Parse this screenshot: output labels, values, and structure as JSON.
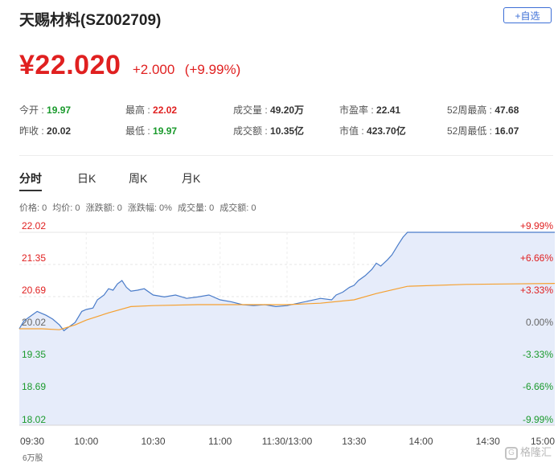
{
  "header": {
    "title": "天赐材料(SZ002709)",
    "add_button": "+自选"
  },
  "quote": {
    "price": "¥22.020",
    "change": "+2.000",
    "change_pct": "(+9.99%)"
  },
  "stats": {
    "row1": [
      {
        "label": "今开 : ",
        "value": "19.97",
        "tone": "green"
      },
      {
        "label": "最高 : ",
        "value": "22.02",
        "tone": "red"
      },
      {
        "label": "成交量 : ",
        "value": "49.20万",
        "tone": "dark"
      },
      {
        "label": "市盈率 : ",
        "value": "22.41",
        "tone": "dark"
      },
      {
        "label": "52周最高 : ",
        "value": "47.68",
        "tone": "dark"
      }
    ],
    "row2": [
      {
        "label": "昨收 : ",
        "value": "20.02",
        "tone": "dark"
      },
      {
        "label": "最低 : ",
        "value": "19.97",
        "tone": "green"
      },
      {
        "label": "成交额 : ",
        "value": "10.35亿",
        "tone": "dark"
      },
      {
        "label": "市值 : ",
        "value": "423.70亿",
        "tone": "dark"
      },
      {
        "label": "52周最低 : ",
        "value": "16.07",
        "tone": "dark"
      }
    ]
  },
  "tabs": [
    {
      "label": "分时",
      "active": true
    },
    {
      "label": "日K",
      "active": false
    },
    {
      "label": "周K",
      "active": false
    },
    {
      "label": "月K",
      "active": false
    }
  ],
  "info_line": [
    "价格: 0",
    "均价: 0",
    "涨跌额: 0",
    "涨跌幅: 0%",
    "成交量: 0",
    "成交额: 0"
  ],
  "volume_label": "6万股",
  "watermark": {
    "logo": "G",
    "text": "格隆汇"
  },
  "colors": {
    "up": "#e02020",
    "down": "#1a9a2c",
    "price_line": "#4a7cc9",
    "avg_line": "#f5a030",
    "area_fill": "#e6ecfa",
    "accent": "#3d6fd6"
  },
  "chart_data": {
    "type": "line",
    "y_left_labels": [
      "22.02",
      "21.35",
      "20.69",
      "20.02",
      "19.35",
      "18.69",
      "18.02"
    ],
    "y_right_labels": [
      "+9.99%",
      "+6.66%",
      "+3.33%",
      "0.00%",
      "-3.33%",
      "-6.66%",
      "-9.99%"
    ],
    "x_labels": [
      "09:30",
      "10:00",
      "10:30",
      "11:00",
      "11:30/13:00",
      "13:30",
      "14:00",
      "14:30",
      "15:00"
    ],
    "ylim": [
      18.02,
      22.02
    ],
    "prev_close": 20.02,
    "grid": true,
    "series": [
      {
        "key": "price",
        "points": [
          [
            0,
            20.02
          ],
          [
            2,
            20.18
          ],
          [
            5,
            20.28
          ],
          [
            8,
            20.38
          ],
          [
            12,
            20.3
          ],
          [
            15,
            20.22
          ],
          [
            18,
            20.1
          ],
          [
            20,
            19.98
          ],
          [
            22,
            20.05
          ],
          [
            25,
            20.15
          ],
          [
            28,
            20.38
          ],
          [
            30,
            20.42
          ],
          [
            33,
            20.45
          ],
          [
            35,
            20.62
          ],
          [
            38,
            20.72
          ],
          [
            40,
            20.85
          ],
          [
            42,
            20.82
          ],
          [
            44,
            20.95
          ],
          [
            46,
            21.02
          ],
          [
            48,
            20.88
          ],
          [
            50,
            20.8
          ],
          [
            53,
            20.82
          ],
          [
            56,
            20.85
          ],
          [
            60,
            20.72
          ],
          [
            65,
            20.68
          ],
          [
            70,
            20.72
          ],
          [
            75,
            20.65
          ],
          [
            80,
            20.68
          ],
          [
            85,
            20.72
          ],
          [
            90,
            20.62
          ],
          [
            95,
            20.58
          ],
          [
            100,
            20.52
          ],
          [
            105,
            20.5
          ],
          [
            110,
            20.52
          ],
          [
            115,
            20.48
          ],
          [
            120,
            20.5
          ],
          [
            125,
            20.55
          ],
          [
            130,
            20.6
          ],
          [
            135,
            20.65
          ],
          [
            140,
            20.62
          ],
          [
            142,
            20.72
          ],
          [
            145,
            20.78
          ],
          [
            148,
            20.88
          ],
          [
            150,
            20.92
          ],
          [
            152,
            21.02
          ],
          [
            155,
            21.12
          ],
          [
            158,
            21.25
          ],
          [
            160,
            21.38
          ],
          [
            162,
            21.32
          ],
          [
            165,
            21.45
          ],
          [
            167,
            21.55
          ],
          [
            170,
            21.78
          ],
          [
            172,
            21.92
          ],
          [
            174,
            22.02
          ],
          [
            200,
            22.02
          ],
          [
            240,
            22.02
          ]
        ]
      },
      {
        "key": "avg",
        "points": [
          [
            0,
            20.02
          ],
          [
            10,
            20.02
          ],
          [
            18,
            20.0
          ],
          [
            25,
            20.1
          ],
          [
            30,
            20.2
          ],
          [
            40,
            20.35
          ],
          [
            50,
            20.48
          ],
          [
            60,
            20.5
          ],
          [
            80,
            20.52
          ],
          [
            100,
            20.52
          ],
          [
            120,
            20.52
          ],
          [
            135,
            20.55
          ],
          [
            150,
            20.62
          ],
          [
            160,
            20.75
          ],
          [
            174,
            20.9
          ],
          [
            200,
            20.94
          ],
          [
            240,
            20.96
          ]
        ]
      }
    ],
    "x_range": [
      0,
      240
    ]
  }
}
